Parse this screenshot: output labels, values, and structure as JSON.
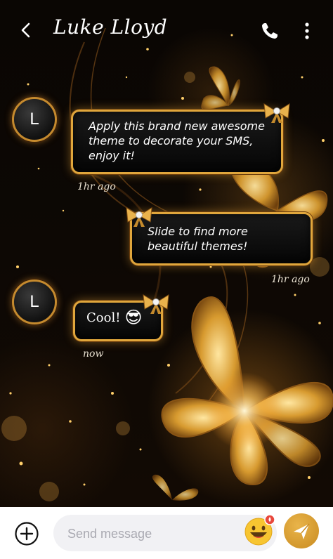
{
  "header": {
    "contact_name": "Luke Lloyd"
  },
  "messages": [
    {
      "from": "contact",
      "avatar_initial": "L",
      "text": "Apply this brand new awesome theme to decorate your SMS, enjoy it!",
      "time": "1hr ago"
    },
    {
      "from": "me",
      "text": "Slide to find more beautiful themes!",
      "time": "1hr ago"
    },
    {
      "from": "contact",
      "avatar_initial": "L",
      "text": "Cool!",
      "emoji": "😎",
      "time": "now"
    }
  ],
  "composer": {
    "placeholder": "Send message",
    "emoji_badge_color": "#e8483c"
  },
  "icons": {
    "back": "back-arrow-icon",
    "call": "phone-icon",
    "more": "more-vertical-icon",
    "add": "plus-circle-icon",
    "emoji": "emoji-face-icon",
    "send": "send-icon"
  },
  "colors": {
    "accent_gold": "#e0a63c",
    "bubble_bg": "#0b0b0b",
    "composer_bg": "#ffffff"
  }
}
